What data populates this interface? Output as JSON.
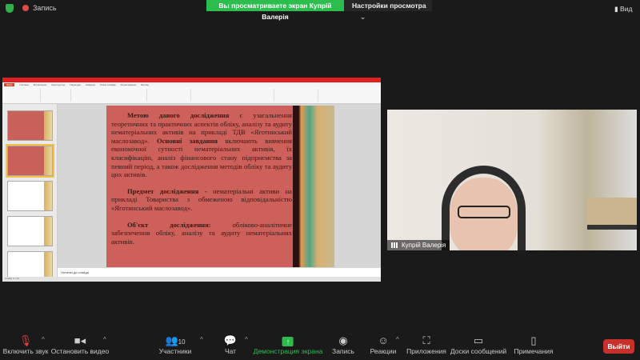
{
  "topbar": {
    "record_label": "Запись",
    "banner": "Вы просматриваете экран Купрій Валерія",
    "view_settings": "Настройки просмотра",
    "view_settings_caret": "⌄",
    "view_button": "Вид"
  },
  "ppt": {
    "tabs": [
      "Файл",
      "Головна",
      "Вставлення",
      "Конструктор",
      "Переходи",
      "Анімація",
      "Показ слайдів",
      "Рецензування",
      "Вигляд"
    ],
    "notes_placeholder": "Нотатки до слайда",
    "status": "Слайд 3 з 15",
    "slide": {
      "p1_bold": "Метою даного дослідження",
      "p1_a": " є узагальнення теоретичних та практичних аспектів обліку, аналізу та аудиту нематеріальних активів на прикладі ТДВ «Яготинський маслозавод». ",
      "p1_bold2": "Основні завдання",
      "p1_b": " включають вивчення економічної сутності нематеріальних активів, їх класифікацію, аналіз фінансового стану підприємства за певний період, а також дослідження методів обліку та аудиту цих активів.",
      "p2_bold": "Предмет дослідження -",
      "p2": " нематеріальні активи на прикладі Товариства з обмеженою відповідальністю «Яготинський маслозавод».",
      "p3_bold": "Об'єкт дослідження:",
      "p3": " обліково-аналітичне забезпечення обліку, аналізу та аудиту нематеріальних активів."
    }
  },
  "video": {
    "participant_name": "Купрій Валерія"
  },
  "toolbar": {
    "unmute": "Включить звук",
    "stop_video": "Остановить видео",
    "participants": "Участники",
    "participants_count": "10",
    "chat": "Чат",
    "share_screen": "Демонстрация экрана",
    "record": "Запись",
    "reactions": "Реакции",
    "apps": "Приложения",
    "whiteboards": "Доски сообщений",
    "notes": "Примечания",
    "leave": "Выйти"
  },
  "colors": {
    "accent_green": "#2dbd4e",
    "leave_red": "#c9302c",
    "slide_bg": "#cd605a"
  }
}
